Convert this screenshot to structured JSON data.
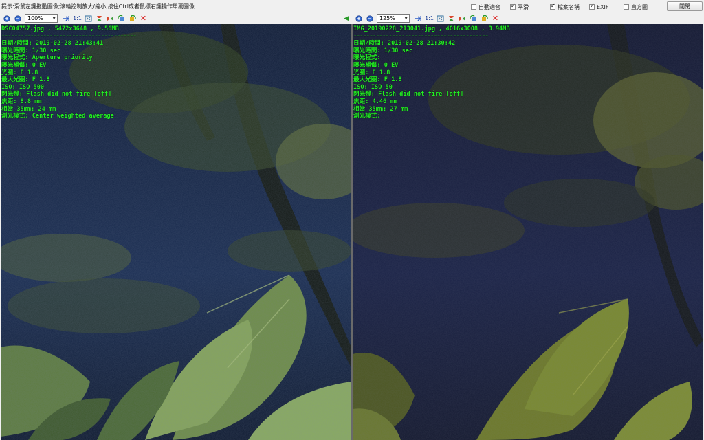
{
  "hint_bar": {
    "text": "提示:滑鼠左鍵拖動圖像;滾輪控制放大/縮小;按住Ctrl或者鼠標右鍵操作單獨圖像"
  },
  "options": [
    {
      "label": "自動適合",
      "checked": false
    },
    {
      "label": "平滑",
      "checked": true
    },
    {
      "label": "檔案名稱",
      "checked": true
    },
    {
      "label": "EXIF",
      "checked": true
    },
    {
      "label": "直方圖",
      "checked": false
    }
  ],
  "close_label": "關閉",
  "toolbar": {
    "actual_size": "1:1",
    "sync_arrow": "◀"
  },
  "left": {
    "zoom": "100%",
    "file_line": "DSC04757.jpg , 5472x3648 , 9.56MB",
    "separator": "------------------------------------------",
    "exif": [
      "日期/時間: 2019-02-28 21:43:41",
      "曝光時間: 1/30 sec",
      "曝光程式: Aperture priority",
      "曝光補償: 0 EV",
      "光圈: F 1.8",
      "最大光圈: F 1.8",
      "ISO: ISO 500",
      "閃光燈: Flash did not fire [off]",
      "焦距: 8.8 mm",
      "相當 35mm: 24 mm",
      "測光模式: Center weighted average"
    ]
  },
  "right": {
    "zoom": "125%",
    "file_line": "IMG_20190228_213041.jpg , 4016x3008 , 3.94MB",
    "separator": "------------------------------------------",
    "exif": [
      "日期/時間: 2019-02-28 21:30:42",
      "曝光時間: 1/30 sec",
      "曝光程式:",
      "曝光補償: 0 EV",
      "光圈: F 1.8",
      "最大光圈: F 1.8",
      "ISO: ISO 50",
      "閃光燈: Flash did not fire [off]",
      "焦距: 4.46 mm",
      "相當 35mm: 27 mm",
      "測光模式:"
    ]
  }
}
